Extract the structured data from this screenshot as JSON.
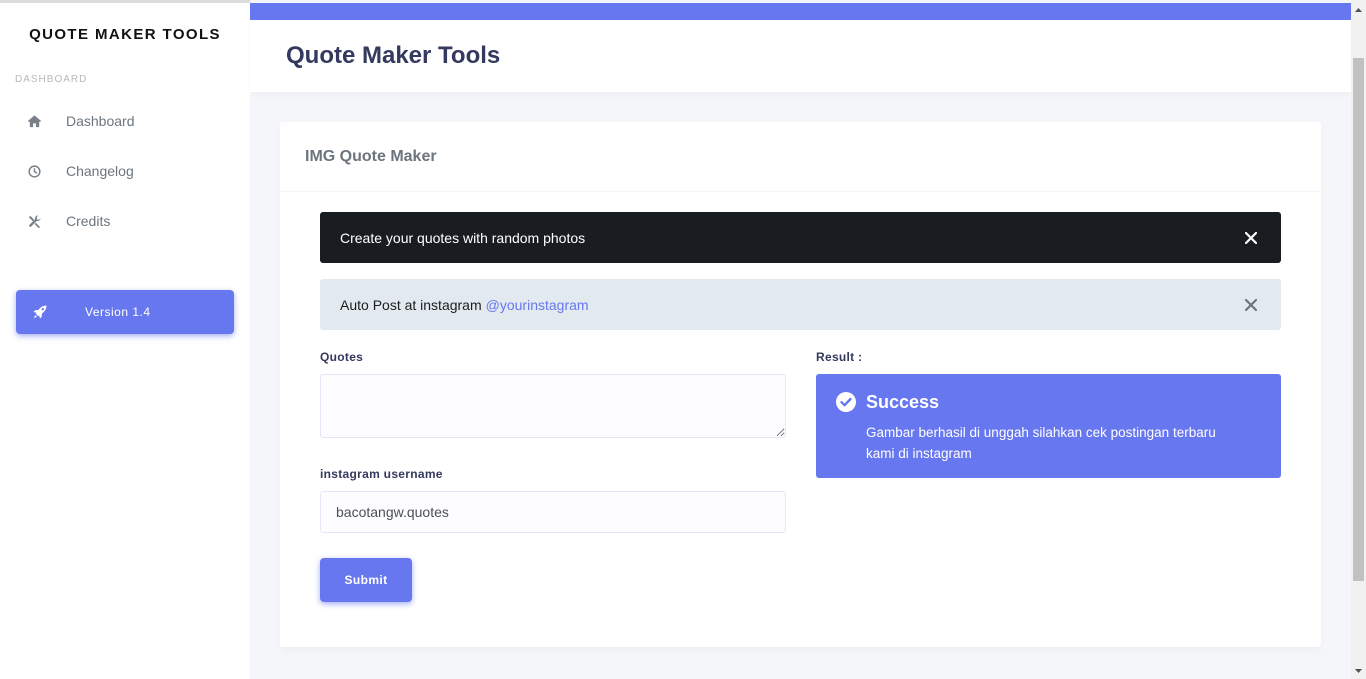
{
  "sidebar": {
    "brand": "QUOTE MAKER TOOLS",
    "menu_header": "DASHBOARD",
    "items": [
      {
        "label": "Dashboard",
        "icon": "home-icon"
      },
      {
        "label": "Changelog",
        "icon": "clock-icon"
      },
      {
        "label": "Credits",
        "icon": "tools-icon"
      }
    ],
    "version_label": "Version 1.4",
    "version_icon": "rocket-icon"
  },
  "header": {
    "title": "Quote Maker Tools"
  },
  "card": {
    "title": "IMG Quote Maker",
    "alerts": [
      {
        "text": "Create your quotes with random photos",
        "style": "dark"
      },
      {
        "text": "Auto Post at instagram",
        "link": "@yourinstagram",
        "style": "light"
      }
    ],
    "form": {
      "quotes_label": "Quotes",
      "quotes_value": "",
      "username_label": "instagram username",
      "username_placeholder": "bacotangw.quotes",
      "submit_label": "Submit"
    },
    "result": {
      "label": "Result :",
      "title": "Success",
      "message": "Gambar berhasil di unggah silahkan cek postingan terbaru kami di instagram"
    }
  },
  "colors": {
    "primary": "#6777ef",
    "dark": "#191d21",
    "light": "#e3eaef"
  }
}
